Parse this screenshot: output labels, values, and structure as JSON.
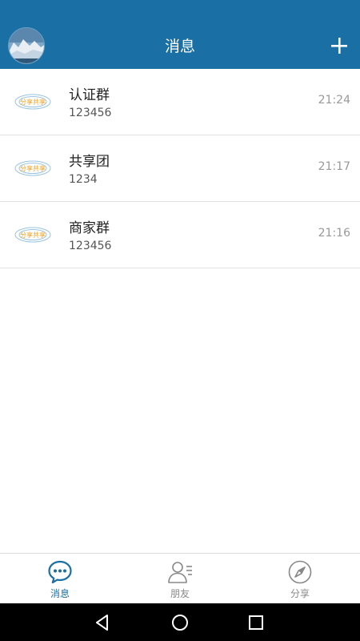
{
  "header": {
    "title": "消息"
  },
  "conversations": [
    {
      "name": "认证群",
      "subtitle": "123456",
      "time": "21:24"
    },
    {
      "name": "共享团",
      "subtitle": "1234",
      "time": "21:17"
    },
    {
      "name": "商家群",
      "subtitle": "123456",
      "time": "21:16"
    }
  ],
  "logo_text": "分享共享",
  "nav": {
    "tabs": [
      {
        "label": "消息",
        "icon": "chat-bubble-icon",
        "active": true
      },
      {
        "label": "朋友",
        "icon": "contacts-icon",
        "active": false
      },
      {
        "label": "分享",
        "icon": "compass-icon",
        "active": false
      }
    ]
  },
  "colors": {
    "header": "#1a6fa5",
    "active_tab": "#1a6fa5",
    "inactive_tab": "#888888",
    "logo": "#f0a020"
  }
}
